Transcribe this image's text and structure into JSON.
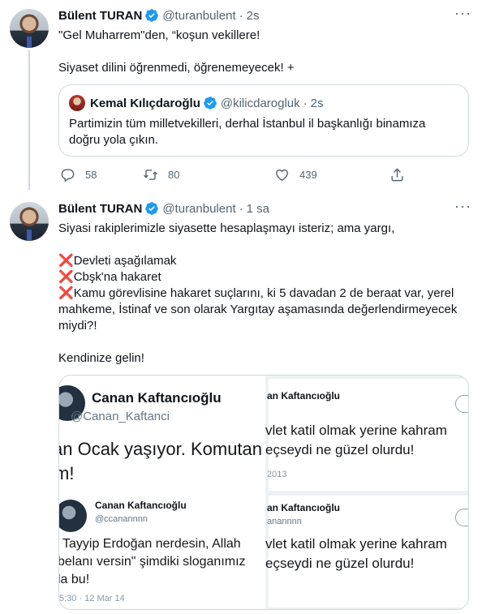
{
  "tweets": [
    {
      "author_name": "Bülent TURAN",
      "handle": "@turanbulent",
      "separator": "·",
      "time": "2s",
      "lines": [
        "\"Gel Muharrem\"den, “koşun vekillere!",
        "Siyaset dilini öğrenmedi, öğrenemeyecek! +"
      ],
      "quote": {
        "author_name": "Kemal Kılıçdaroğlu",
        "handle": "@kilicdarogluk",
        "separator": "·",
        "time": "2s",
        "text": "Partimizin tüm milletvekilleri, derhal İstanbul il başkanlığı binamıza doğru yola çıkın."
      },
      "actions": {
        "replies": "58",
        "retweets": "80",
        "likes": "439"
      }
    },
    {
      "author_name": "Bülent TURAN",
      "handle": "@turanbulent",
      "separator": "·",
      "time": "1 sa",
      "intro": "Siyasi rakiplerimizle siyasette hesaplaşmayı isteriz; ama yargı,",
      "items": [
        "Devleti aşağılamak",
        "Cbşk'na hakaret",
        "Kamu görevlisine hakaret suçlarını, ki 5 davadan 2 de beraat var, yerel mahkeme, İstinaf ve son olarak Yargıtay aşamasında değerlendirmeyecek miydi?!"
      ],
      "item_marker": "❌",
      "closing": "Kendinize gelin!",
      "media": {
        "panel_a": {
          "name": "Canan Kaftancıoğlu",
          "handle": "@Canan_Kaftanci",
          "text_line1": "an Ocak yaşıyor. Komutan",
          "text_line2": "m!"
        },
        "panel_b": {
          "name": "Canan Kaftancıoğlu",
          "handle": "@ccanannnn",
          "text_line1": "Tayyip Erdoğan nerdesin, Allah",
          "text_line2": "belanı versin\" şimdiki sloganımız",
          "text_line3": "la bu!",
          "date": "5:30 · 12 Mar 14"
        },
        "panel_c": {
          "name": "an Kaftancıoğlu",
          "text_line1": "vlet katil olmak yerine kahram",
          "text_line2": "eçseydi ne güzel olurdu!",
          "date": "2013"
        },
        "panel_d": {
          "name": "an Kaftancıoğlu",
          "handle": "anannnn",
          "text_line1": "vlet katil olmak yerine kahram",
          "text_line2": "eçseydi ne güzel olurdu!"
        }
      }
    }
  ],
  "colors": {
    "accent": "#1d9bf0",
    "text": "#0f1419",
    "muted": "#536471",
    "border": "#cfd9de",
    "cross": "#e0245e"
  },
  "icons": [
    "verified-badge-icon",
    "more-icon",
    "reply-icon",
    "retweet-icon",
    "like-icon",
    "share-icon",
    "cross-mark-icon"
  ]
}
